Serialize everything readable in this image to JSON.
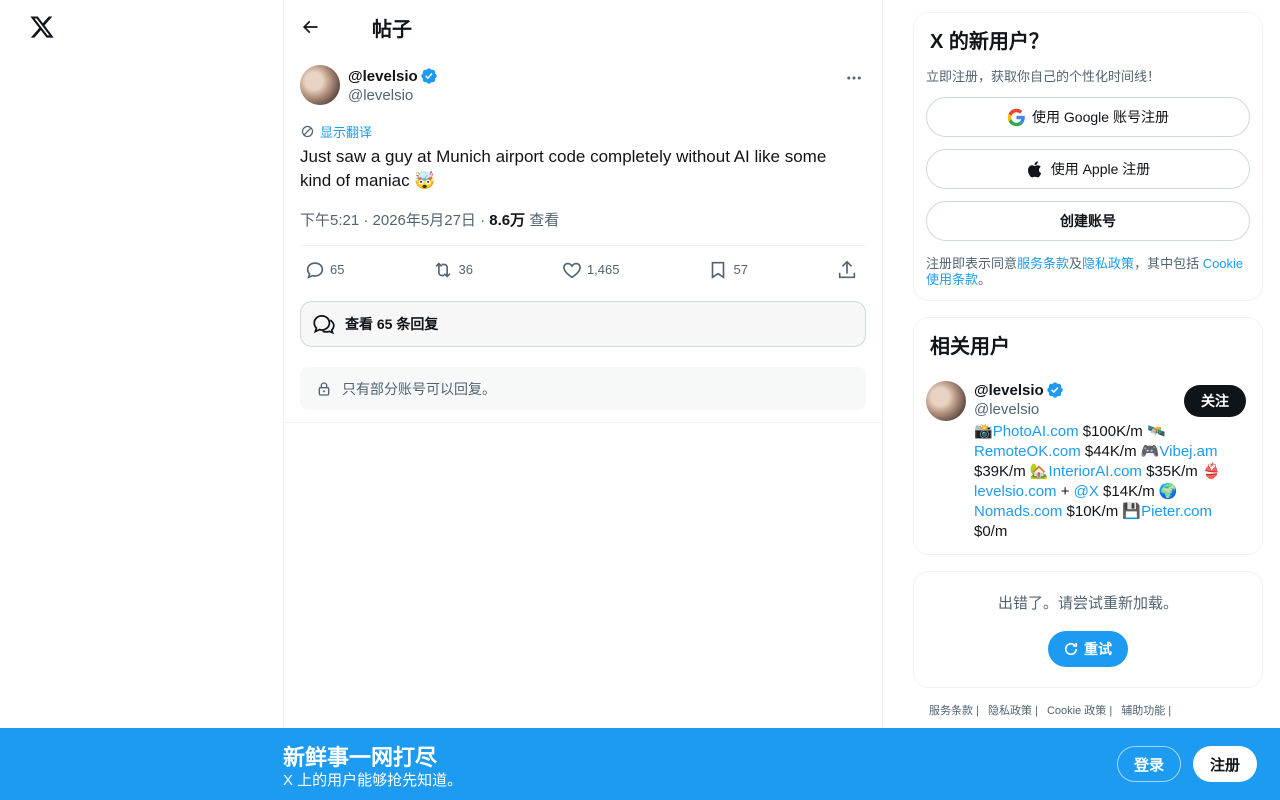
{
  "page": {
    "title": "帖子"
  },
  "tweet": {
    "display_name": "@levelsio",
    "handle": "@levelsio",
    "translate_label": "显示翻译",
    "text": "Just saw a guy at Munich airport code completely without AI like some kind of maniac 🤯",
    "time": "下午5:21 · 2026年5月27日 · ",
    "views_count": "8.6万",
    "views_label": " 查看",
    "replies": "65",
    "retweets": "36",
    "likes": "1,465",
    "bookmarks": "57",
    "view_replies_label": "查看 65 条回复",
    "reply_limit_text": "只有部分账号可以回复。"
  },
  "signup_card": {
    "title": "X 的新用户？",
    "subtitle": "立即注册，获取你自己的个性化时间线！",
    "google_label": "使用 Google 账号注册",
    "apple_label": "使用 Apple 注册",
    "create_label": "创建账号",
    "terms_prefix": "注册即表示同意",
    "terms_link": "服务条款",
    "and": "及",
    "privacy_link": "隐私政策",
    "terms_mid": "，其中包括 ",
    "cookie_link": "Cookie 使用条款",
    "terms_end": "。"
  },
  "related": {
    "title": "相关用户",
    "display_name": "@levelsio",
    "handle": "@levelsio",
    "follow_label": "关注",
    "bio": [
      {
        "t": "text",
        "v": "📸"
      },
      {
        "t": "link",
        "v": "PhotoAI.com"
      },
      {
        "t": "text",
        "v": " $100K/m 🛰️ "
      },
      {
        "t": "link",
        "v": "RemoteOK.com"
      },
      {
        "t": "text",
        "v": " $44K/m 🎮"
      },
      {
        "t": "link",
        "v": "Vibej.am"
      },
      {
        "t": "text",
        "v": " $39K/m 🏡"
      },
      {
        "t": "link",
        "v": "InteriorAI.com"
      },
      {
        "t": "text",
        "v": " $35K/m 👙 "
      },
      {
        "t": "link",
        "v": "levelsio.com"
      },
      {
        "t": "text",
        "v": " + "
      },
      {
        "t": "link",
        "v": "@X"
      },
      {
        "t": "text",
        "v": " $14K/m 🌍 "
      },
      {
        "t": "link",
        "v": "Nomads.com"
      },
      {
        "t": "text",
        "v": " $10K/m 💾"
      },
      {
        "t": "link",
        "v": "Pieter.com"
      },
      {
        "t": "text",
        "v": " $0/m"
      }
    ]
  },
  "error_card": {
    "message": "出错了。请尝试重新加载。",
    "retry_label": "重试"
  },
  "footer": [
    "服务条款 |",
    "隐私政策 |",
    "Cookie 政策 |",
    "辅助功能 |"
  ],
  "banner": {
    "title": "新鲜事一网打尽",
    "subtitle": "X 上的用户能够抢先知道。",
    "login_label": "登录",
    "signup_label": "注册"
  },
  "colors": {
    "accent": "#1d9bf0",
    "text": "#0f1419",
    "muted": "#536471"
  }
}
